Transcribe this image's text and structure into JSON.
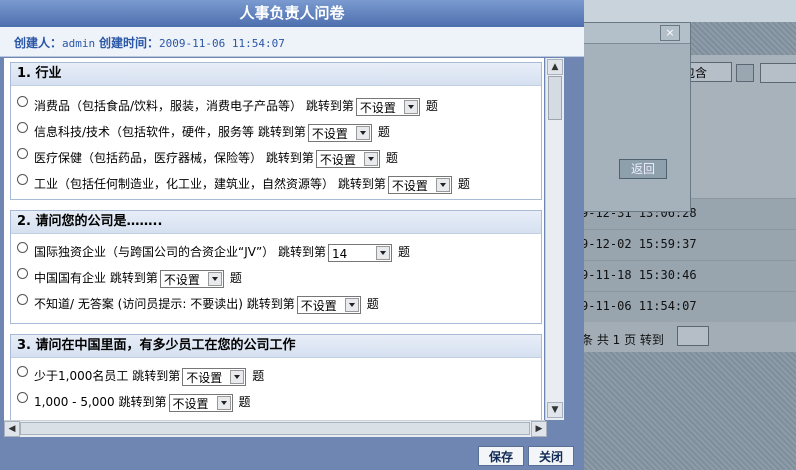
{
  "dialog": {
    "title": "人事负责人问卷",
    "creator_label": "创建人：",
    "creator_value": "admin",
    "created_label": "创建时间：",
    "created_value": "2009-11-06 11:54:07",
    "save_label": "保存",
    "close_label": "关闭"
  },
  "questions": [
    {
      "title": "1. 行业",
      "options": [
        {
          "text": "消费品（包括食品/饮料，服装，消费电子产品等）",
          "jump": "跳转到第",
          "value": "不设置",
          "suffix": "题"
        },
        {
          "text": "信息科技/技术（包括软件，硬件，服务等",
          "jump": "跳转到第",
          "value": "不设置",
          "suffix": "题"
        },
        {
          "text": "医疗保健（包括药品，医疗器械，保险等）",
          "jump": "跳转到第",
          "value": "不设置",
          "suffix": "题"
        },
        {
          "text": "工业（包括任何制造业，化工业，建筑业，自然资源等）",
          "jump": "跳转到第",
          "value": "不设置",
          "suffix": "题"
        }
      ]
    },
    {
      "title": "2. 请问您的公司是……..",
      "options": [
        {
          "text": "国际独资企业（与跨国公司的合资企业“JV”）",
          "jump": "跳转到第",
          "value": "14",
          "suffix": "题"
        },
        {
          "text": "中国国有企业",
          "jump": "跳转到第",
          "value": "不设置",
          "suffix": "题"
        },
        {
          "text": "不知道/ 无答案 (访问员提示: 不要读出)",
          "jump": "跳转到第",
          "value": "不设置",
          "suffix": "题"
        }
      ]
    },
    {
      "title": "3. 请问在中国里面，有多少员工在您的公司工作",
      "options": [
        {
          "text": "少于1,000名员工",
          "jump": "跳转到第",
          "value": "不设置",
          "suffix": "题"
        },
        {
          "text": "1,000 - 5,000",
          "jump": "跳转到第",
          "value": "不设置",
          "suffix": "题"
        }
      ]
    }
  ],
  "background": {
    "filter_value": "包含",
    "dialog_button": "返回",
    "dialog_close": "×",
    "rows": [
      "9-12-31 13:06:28",
      "9-12-02 15:59:37",
      "9-11-18 15:30:46",
      "9-11-06 11:54:07"
    ],
    "pager_text": "条 共 1 页 转到"
  }
}
